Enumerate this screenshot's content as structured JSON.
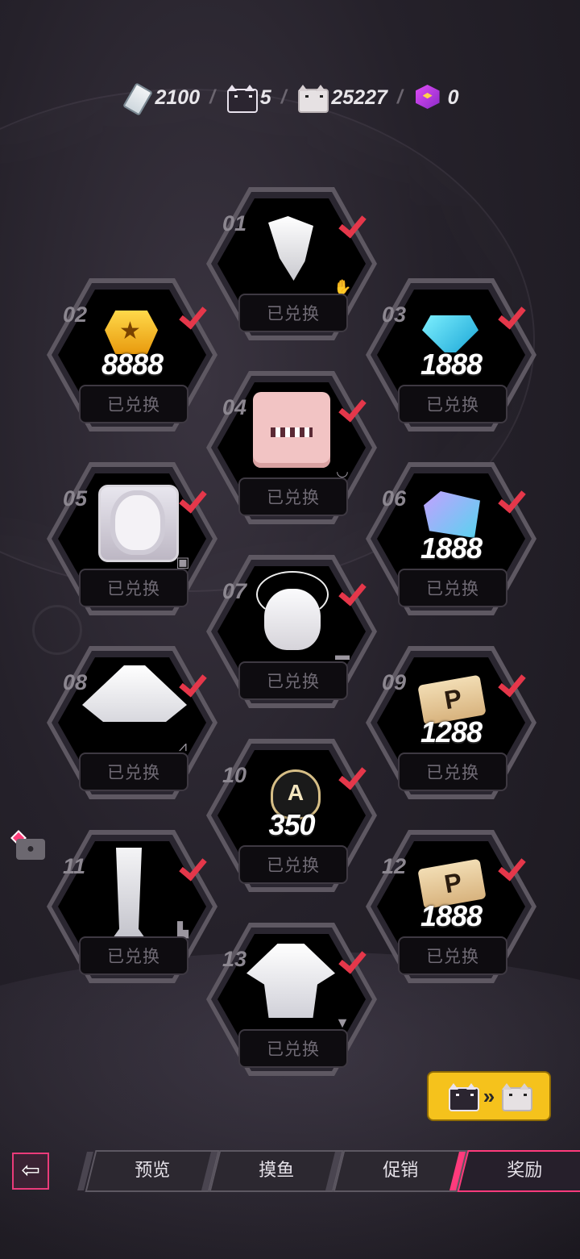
{
  "currency": [
    {
      "icon": "milk-bottle-icon",
      "value": "2100"
    },
    {
      "icon": "black-cat-block-icon",
      "value": "5"
    },
    {
      "icon": "white-cat-block-icon",
      "value": "25227"
    },
    {
      "icon": "purple-cube-icon",
      "value": "0"
    }
  ],
  "currency_separator": "/",
  "rewards": [
    {
      "num": "01",
      "qty": "",
      "status": "已兑换",
      "item": "costume-piece",
      "tag": "glove-icon"
    },
    {
      "num": "02",
      "qty": "8888",
      "status": "已兑换",
      "item": "gold-coin",
      "tag": ""
    },
    {
      "num": "03",
      "qty": "1888",
      "status": "已兑换",
      "item": "blue-gem",
      "tag": ""
    },
    {
      "num": "04",
      "qty": "",
      "status": "已兑换",
      "item": "mouth-face",
      "tag": "lips-icon"
    },
    {
      "num": "05",
      "qty": "",
      "status": "已兑换",
      "item": "portrait",
      "tag": "avatar-icon"
    },
    {
      "num": "06",
      "qty": "1888",
      "status": "已兑换",
      "item": "prism-crystal",
      "tag": ""
    },
    {
      "num": "07",
      "qty": "",
      "status": "已兑换",
      "item": "white-hair",
      "tag": "hat-icon"
    },
    {
      "num": "08",
      "qty": "",
      "status": "已兑换",
      "item": "white-skirt",
      "tag": "skirt-icon"
    },
    {
      "num": "09",
      "qty": "1288",
      "status": "已兑换",
      "item": "p-ticket",
      "tag": ""
    },
    {
      "num": "10",
      "qty": "350",
      "status": "已兑换",
      "item": "ace-emblem",
      "tag": ""
    },
    {
      "num": "11",
      "qty": "",
      "status": "已兑换",
      "item": "white-boots",
      "tag": "shoe-icon"
    },
    {
      "num": "12",
      "qty": "1888",
      "status": "已兑换",
      "item": "p-ticket",
      "tag": ""
    },
    {
      "num": "13",
      "qty": "",
      "status": "已兑换",
      "item": "white-top",
      "tag": "shirt-icon"
    }
  ],
  "exchange_button": {
    "arrow": "»"
  },
  "tabs": [
    {
      "label": "预览",
      "active": false
    },
    {
      "label": "摸鱼",
      "active": false
    },
    {
      "label": "促销",
      "active": false
    },
    {
      "label": "奖励",
      "active": true
    }
  ],
  "colors": {
    "accent": "#ff3b7c",
    "check": "#e5374a",
    "exchange": "#f5c21c"
  }
}
